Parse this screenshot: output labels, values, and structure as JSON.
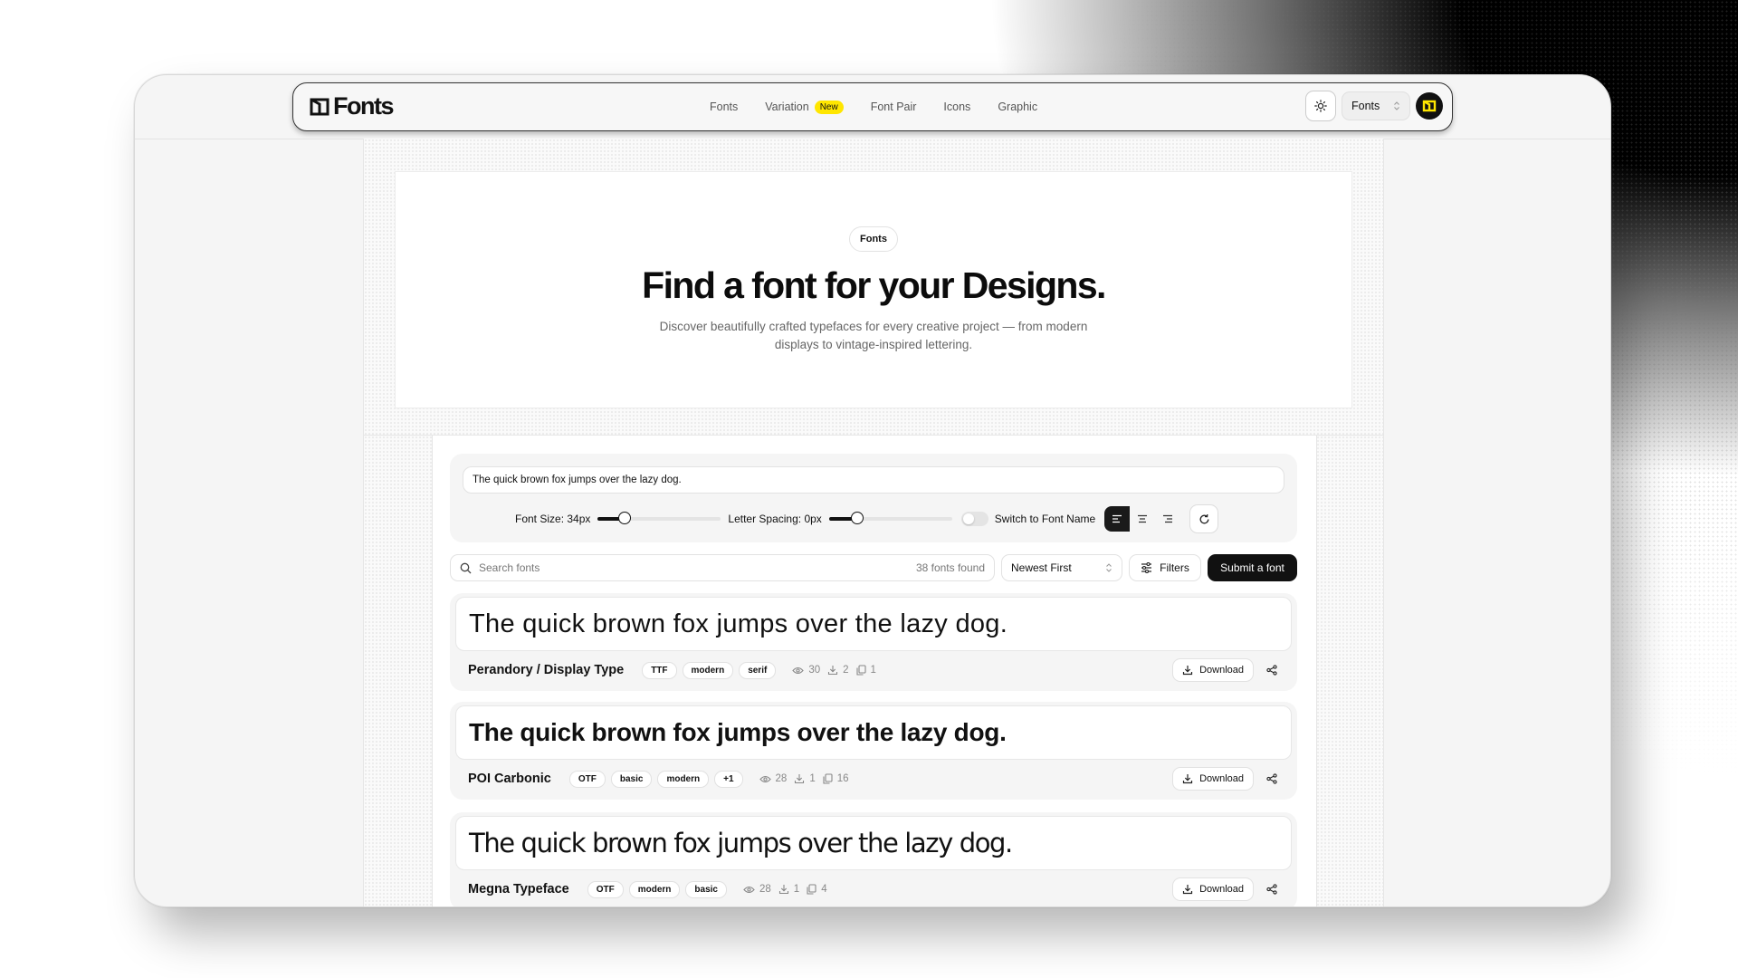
{
  "brand": {
    "name": "Fonts"
  },
  "nav": {
    "links": [
      {
        "label": "Fonts"
      },
      {
        "label": "Variation",
        "badge": "New"
      },
      {
        "label": "Font Pair"
      },
      {
        "label": "Icons"
      },
      {
        "label": "Graphic"
      }
    ],
    "select_value": "Fonts",
    "icons": [
      "sun-icon",
      "chevron-updown-icon",
      "logo-icon"
    ]
  },
  "hero": {
    "pill": "Fonts",
    "title": "Find a font for your Designs.",
    "subtitle": "Discover beautifully crafted typefaces for every creative project — from modern displays to vintage-inspired lettering."
  },
  "controls": {
    "preview_text": "The quick brown fox jumps over the lazy dog.",
    "font_size_label": "Font Size: 34px",
    "font_size_level": 0.22,
    "letter_spacing_label": "Letter Spacing: 0px",
    "letter_spacing_level": 0.23,
    "switch_label": "Switch to Font Name",
    "switch_on": false,
    "alignment": "left"
  },
  "toolbar": {
    "search_placeholder": "Search fonts",
    "count": "38 fonts found",
    "sort_value": "Newest First",
    "filters_label": "Filters",
    "submit_label": "Submit a font"
  },
  "fonts": [
    {
      "preview": "The quick brown fox jumps over the lazy dog.",
      "name": "Perandory / Display Type",
      "tags": [
        "TTF",
        "modern",
        "serif"
      ],
      "views": "30",
      "downloads": "2",
      "copies": "1",
      "download_label": "Download"
    },
    {
      "preview": "The quick brown fox jumps over the lazy dog.",
      "name": "POI Carbonic",
      "tags": [
        "OTF",
        "basic",
        "modern",
        "+1"
      ],
      "views": "28",
      "downloads": "1",
      "copies": "16",
      "download_label": "Download"
    },
    {
      "preview": "The quick brown fox jumps over the lazy dog.",
      "name": "Megna Typeface",
      "tags": [
        "OTF",
        "modern",
        "basic"
      ],
      "views": "28",
      "downloads": "1",
      "copies": "4",
      "download_label": "Download"
    }
  ],
  "colors": {
    "accent": "#ffe600",
    "primary": "#111111",
    "page_bg": "#f5f5f5"
  }
}
